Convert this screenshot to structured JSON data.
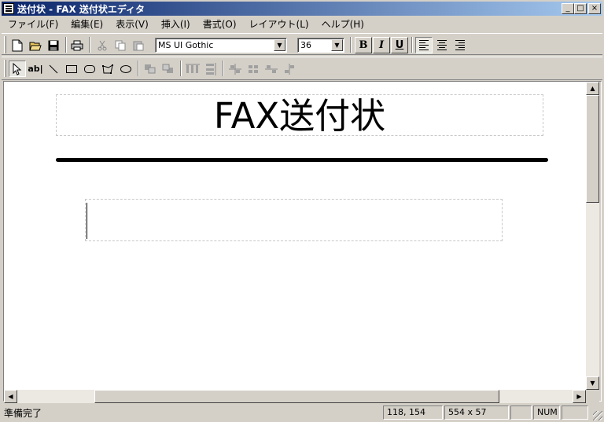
{
  "window": {
    "title": "送付状 - FAX 送付状エディタ",
    "buttons": {
      "minimize": "_",
      "maximize": "□",
      "close": "×"
    }
  },
  "menu": [
    "ファイル(F)",
    "編集(E)",
    "表示(V)",
    "挿入(I)",
    "書式(O)",
    "レイアウト(L)",
    "ヘルプ(H)"
  ],
  "toolbar": {
    "font_name": "MS UI Gothic",
    "font_size": "36",
    "bold": "B",
    "italic": "I",
    "underline": "U"
  },
  "drawing_toolbar": {
    "text_tool": "ab|"
  },
  "document": {
    "title_text": "FAX送付状",
    "body_text": ""
  },
  "status": {
    "message": "準備完了",
    "position": "118, 154",
    "size": "554 x 57",
    "num": "NUM"
  }
}
